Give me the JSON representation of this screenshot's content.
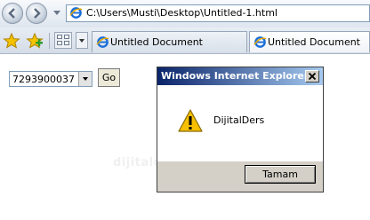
{
  "browser": {
    "address": "C:\\Users\\Musti\\Desktop\\Untitled-1.html",
    "tabs": [
      {
        "label": "Untitled Document",
        "active": false
      },
      {
        "label": "Untitled Document",
        "active": true
      }
    ]
  },
  "page": {
    "select_value": "7293900037",
    "go_label": "Go",
    "watermark": "dijitalders.com"
  },
  "dialog": {
    "title": "Windows Internet Explorer",
    "message": "DijitalDers",
    "ok_label": "Tamam"
  },
  "colors": {
    "title_bar_start": "#0a246a",
    "title_bar_end": "#a6caf0",
    "dialog_face": "#d4d0c8",
    "warning": "#f6c000"
  }
}
